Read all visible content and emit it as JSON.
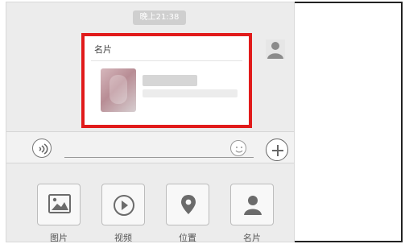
{
  "chat": {
    "time_label": "晚上21:38",
    "card_title": "名片"
  },
  "attachment_bar": {
    "items": [
      {
        "label": "图片",
        "icon": "image-icon"
      },
      {
        "label": "视频",
        "icon": "video-icon"
      },
      {
        "label": "位置",
        "icon": "location-icon"
      },
      {
        "label": "名片",
        "icon": "contact-card-icon"
      }
    ]
  },
  "colors": {
    "highlight_border": "#e11b1b",
    "background": "#ececec"
  }
}
